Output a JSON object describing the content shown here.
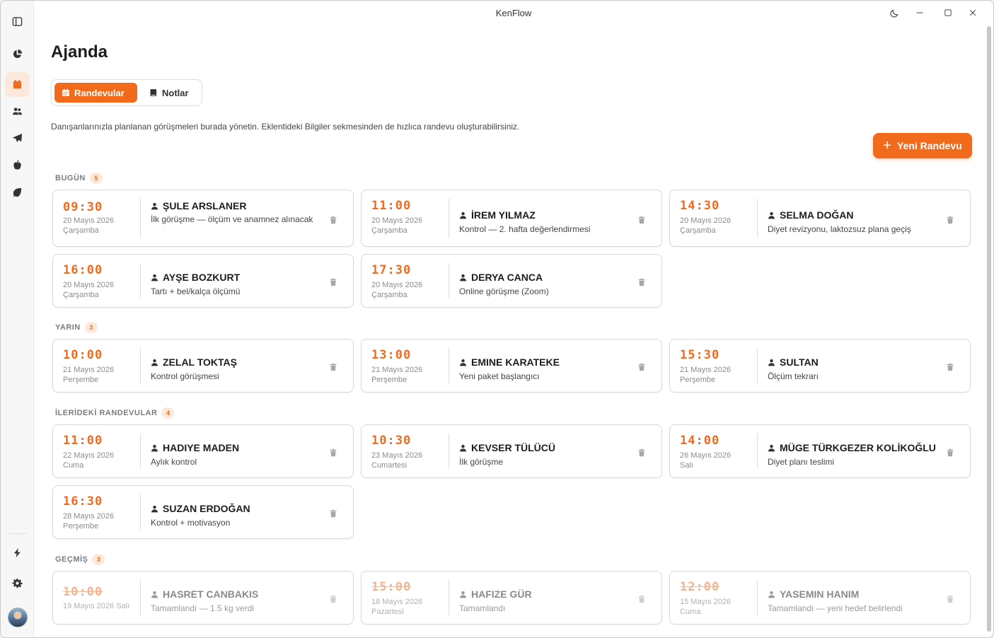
{
  "app": {
    "title": "KenFlow"
  },
  "page": {
    "title": "Ajanda",
    "description": "Danışanlarınızla planlanan görüşmeleri burada yönetin. Eklentideki Bilgiler sekmesinden de hızlıca randevu oluşturabilirsiniz.",
    "new_button": "Yeni Randevu"
  },
  "tabs": [
    {
      "label": "Randevular",
      "icon": "calendar-icon",
      "active": true
    },
    {
      "label": "Notlar",
      "icon": "book-icon",
      "active": false
    }
  ],
  "sidebar": {
    "items": [
      {
        "name": "sidebar-toggle",
        "icon": "sidebar-icon"
      },
      {
        "name": "dashboard",
        "icon": "pie-chart-icon"
      },
      {
        "name": "agenda",
        "icon": "calendar-icon",
        "active": true
      },
      {
        "name": "clients",
        "icon": "users-icon"
      },
      {
        "name": "messages",
        "icon": "send-icon"
      },
      {
        "name": "nutrition",
        "icon": "apple-icon"
      },
      {
        "name": "plans",
        "icon": "leaf-icon"
      }
    ],
    "bottom": [
      {
        "name": "quick-actions",
        "icon": "bolt-icon"
      },
      {
        "name": "settings",
        "icon": "gear-icon"
      }
    ]
  },
  "sections": {
    "today": {
      "label": "BUGÜN",
      "count": "5",
      "items": [
        {
          "time": "09:30",
          "date": "20 Mayıs 2026",
          "day": "Çarşamba",
          "name": "ŞULE ARSLANER",
          "note": "İlk görüşme — ölçüm ve anamnez alınacak"
        },
        {
          "time": "11:00",
          "date": "20 Mayıs 2026",
          "day": "Çarşamba",
          "name": "İREM YILMAZ",
          "note": "Kontrol — 2. hafta değerlendirmesi"
        },
        {
          "time": "14:30",
          "date": "20 Mayıs 2026",
          "day": "Çarşamba",
          "name": "SELMA DOĞAN",
          "note": "Diyet revizyonu, laktozsuz plana geçiş"
        },
        {
          "time": "16:00",
          "date": "20 Mayıs 2026",
          "day": "Çarşamba",
          "name": "AYŞE BOZKURT",
          "note": "Tartı + bel/kalça ölçümü"
        },
        {
          "time": "17:30",
          "date": "20 Mayıs 2026",
          "day": "Çarşamba",
          "name": "DERYA CANCA",
          "note": "Online görüşme (Zoom)"
        }
      ]
    },
    "tomorrow": {
      "label": "YARIN",
      "count": "3",
      "items": [
        {
          "time": "10:00",
          "date": "21 Mayıs 2026",
          "day": "Perşembe",
          "name": "ZELAL TOKTAŞ",
          "note": "Kontrol görüşmesi"
        },
        {
          "time": "13:00",
          "date": "21 Mayıs 2026",
          "day": "Perşembe",
          "name": "EMINE KARATEKE",
          "note": "Yeni paket başlangıcı"
        },
        {
          "time": "15:30",
          "date": "21 Mayıs 2026",
          "day": "Perşembe",
          "name": "SULTAN",
          "note": "Ölçüm tekrarı"
        }
      ]
    },
    "upcoming": {
      "label": "İLERİDEKİ RANDEVULAR",
      "count": "4",
      "items": [
        {
          "time": "11:00",
          "date": "22 Mayıs 2026",
          "day": "Cuma",
          "name": "HADIYE MADEN",
          "note": "Aylık kontrol"
        },
        {
          "time": "10:30",
          "date": "23 Mayıs 2026",
          "day": "Cumartesi",
          "name": "KEVSER TÜLÜCÜ",
          "note": "İlk görüşme"
        },
        {
          "time": "14:00",
          "date": "26 Mayıs 2026",
          "day": "Salı",
          "name": "MÜGE TÜRKGEZER KOLİKOĞLU",
          "note": "Diyet planı teslimi"
        },
        {
          "time": "16:30",
          "date": "28 Mayıs 2026",
          "day": "Perşembe",
          "name": "SUZAN ERDOĞAN",
          "note": "Kontrol + motivasyon"
        }
      ]
    },
    "past": {
      "label": "GEÇMİŞ",
      "count": "3",
      "items": [
        {
          "time": "10:00",
          "date": "19 Mayıs 2026 Salı",
          "day": "",
          "name": "HASRET CANBAKIS",
          "note": "Tamamlandı — 1.5 kg verdi"
        },
        {
          "time": "15:00",
          "date": "18 Mayıs 2026",
          "day": "Pazartesi",
          "name": "HAFIZE GÜR",
          "note": "Tamamlandı"
        },
        {
          "time": "12:00",
          "date": "15 Mayıs 2026",
          "day": "Cuma",
          "name": "YASEMIN HANIM",
          "note": "Tamamlandı — yeni hedef belirlendi"
        }
      ]
    }
  },
  "colors": {
    "accent": "#f26a1b",
    "accent_soft": "#fde9dc",
    "muted": "#8b8b90"
  }
}
